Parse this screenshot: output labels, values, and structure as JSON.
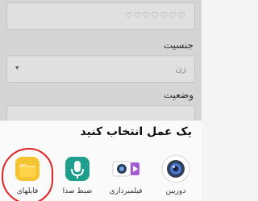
{
  "form": {
    "name_field_value": "♡♡♡♡♡♡♡",
    "gender_label": "جنسیت",
    "gender_value": "زن",
    "gender_arrow": "▾",
    "status_label": "وضعیت"
  },
  "sheet": {
    "title": "یک عمل انتخاب کنید",
    "apps": [
      {
        "label": "دوربین",
        "icon": "camera-icon"
      },
      {
        "label": "فیلمبرداری",
        "icon": "video-camera-icon"
      },
      {
        "label": "ضبط صدا",
        "icon": "microphone-icon"
      },
      {
        "label": "فایلهای",
        "icon": "folder-icon"
      }
    ]
  },
  "colors": {
    "camera_bg": "#ffffff",
    "video_bg": "#ffffff",
    "recorder_bg": "#1f9e8e",
    "files_bg": "#f4c430",
    "highlight": "#e02222"
  }
}
